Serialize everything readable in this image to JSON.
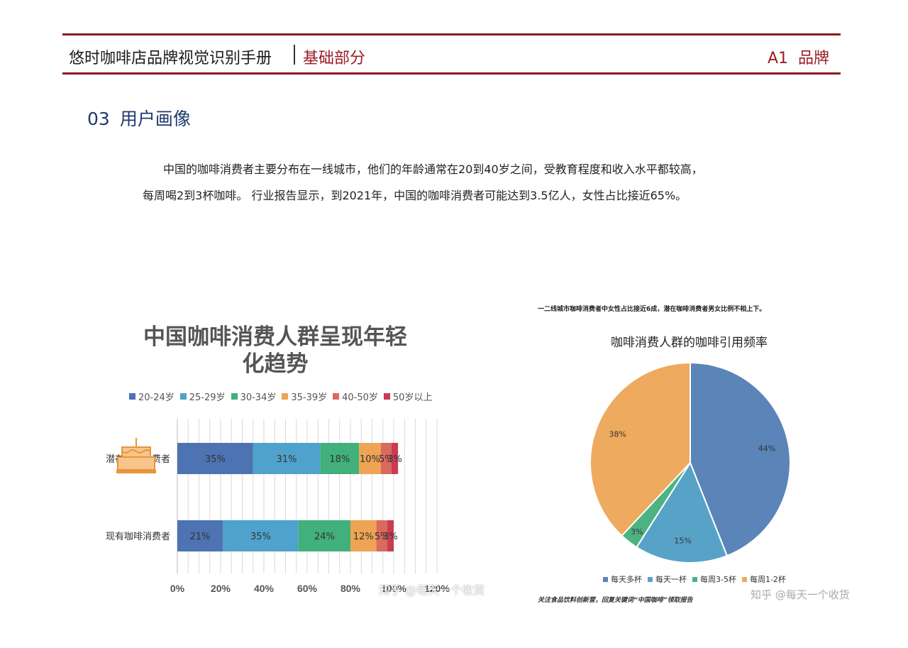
{
  "header": {
    "title": "悠时咖啡店品牌视觉识别手册",
    "section": "基础部分",
    "code": "A1",
    "category": "品牌"
  },
  "section": {
    "number": "03",
    "title": "用户画像"
  },
  "paragraph": {
    "line1": "中国的咖啡消费者主要分布在一线城市，他们的年龄通常在20到40岁之间，受教育程度和收入水平都较高，",
    "line2": "每周喝2到3杯咖啡。  行业报告显示，到2021年，中国的咖啡消费者可能达到3.5亿人，女性占比接近65%。"
  },
  "left_figure": {
    "watermark": "知乎 @每天一个收货"
  },
  "right_figure": {
    "note": "一二线城市咖啡消费者中女性占比接近6成，潜在咖啡消费者男女比例不相上下。",
    "footnote": "关注食品饮料创新营，回复关键词“中国咖啡”领取报告",
    "watermark": "知乎 @每天一个收货"
  },
  "chart_data": [
    {
      "type": "bar",
      "orientation": "horizontal",
      "stacked": true,
      "title": "中国咖啡消费人群呈现年轻化趋势",
      "categories": [
        "潜在咖啡消费者",
        "现有咖啡消费者"
      ],
      "series": [
        {
          "name": "20-24岁",
          "values": [
            35,
            21
          ],
          "color": "#4e73b2"
        },
        {
          "name": "25-29岁",
          "values": [
            31,
            35
          ],
          "color": "#4fa2cc"
        },
        {
          "name": "30-34岁",
          "values": [
            18,
            24
          ],
          "color": "#41b07c"
        },
        {
          "name": "35-39岁",
          "values": [
            10,
            12
          ],
          "color": "#eea454"
        },
        {
          "name": "40-50岁",
          "values": [
            5,
            5
          ],
          "color": "#d96a5e"
        },
        {
          "name": "50岁以上",
          "values": [
            3,
            3
          ],
          "color": "#c93c52"
        }
      ],
      "xlim": [
        0,
        120
      ],
      "xticks": [
        "0%",
        "20%",
        "40%",
        "60%",
        "80%",
        "100%",
        "120%"
      ],
      "legend": "top",
      "grid": true
    },
    {
      "type": "pie",
      "title": "咖啡消费人群的咖啡引用频率",
      "slices": [
        {
          "name": "每天多杯",
          "value": 44,
          "label": "44%",
          "color": "#5b84b8"
        },
        {
          "name": "每天一杯",
          "value": 15,
          "label": "15%",
          "color": "#57a3c7"
        },
        {
          "name": "每周3-5杯",
          "value": 3,
          "label": "3%",
          "color": "#4db383"
        },
        {
          "name": "每周1-2杯",
          "value": 38,
          "label": "38%",
          "color": "#eeaa5e"
        }
      ],
      "legend": "bottom"
    }
  ]
}
